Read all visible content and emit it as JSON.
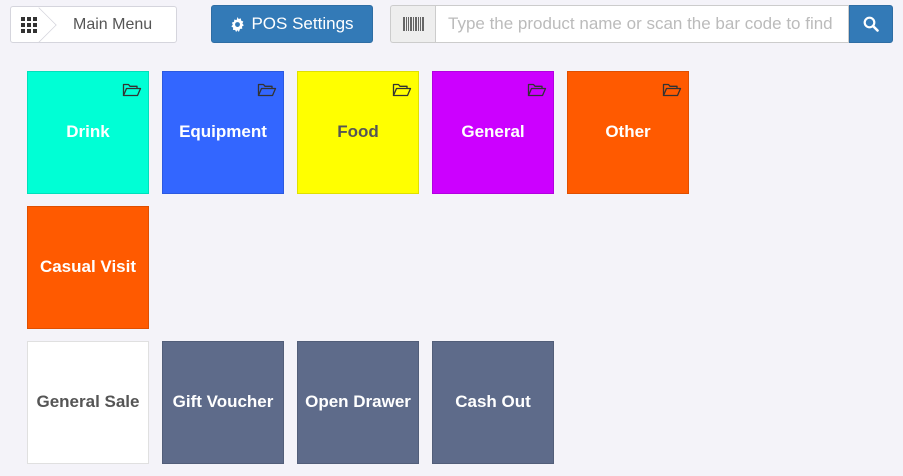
{
  "breadcrumb": {
    "home_icon": "grid-icon",
    "label": "Main Menu"
  },
  "toolbar": {
    "pos_settings_label": "POS Settings",
    "pos_settings_icon": "gear-icon",
    "accent_color": "#337ab7"
  },
  "search": {
    "placeholder": "Type the product name or scan the bar code to find t",
    "value": "",
    "barcode_icon": "barcode-icon",
    "button_icon": "search-icon"
  },
  "categories": [
    {
      "label": "Drink",
      "bg": "#00ffd5",
      "fg": "#ffffff",
      "icon": "folder-open-icon"
    },
    {
      "label": "Equipment",
      "bg": "#3366ff",
      "fg": "#ffffff",
      "icon": "folder-open-icon"
    },
    {
      "label": "Food",
      "bg": "#ffff00",
      "fg": "#555555",
      "icon": "folder-open-icon"
    },
    {
      "label": "General",
      "bg": "#cc00ff",
      "fg": "#ffffff",
      "icon": "folder-open-icon"
    },
    {
      "label": "Other",
      "bg": "#ff5a00",
      "fg": "#ffffff",
      "icon": "folder-open-icon"
    }
  ],
  "products": [
    {
      "label": "Casual Visit",
      "bg": "#ff5a00",
      "fg": "#ffffff"
    }
  ],
  "actions": [
    {
      "label": "General Sale",
      "bg": "#ffffff",
      "fg": "#555555"
    },
    {
      "label": "Gift Voucher",
      "bg": "#5e6b8a",
      "fg": "#ffffff"
    },
    {
      "label": "Open Drawer",
      "bg": "#5e6b8a",
      "fg": "#ffffff"
    },
    {
      "label": "Cash Out",
      "bg": "#5e6b8a",
      "fg": "#ffffff"
    }
  ]
}
